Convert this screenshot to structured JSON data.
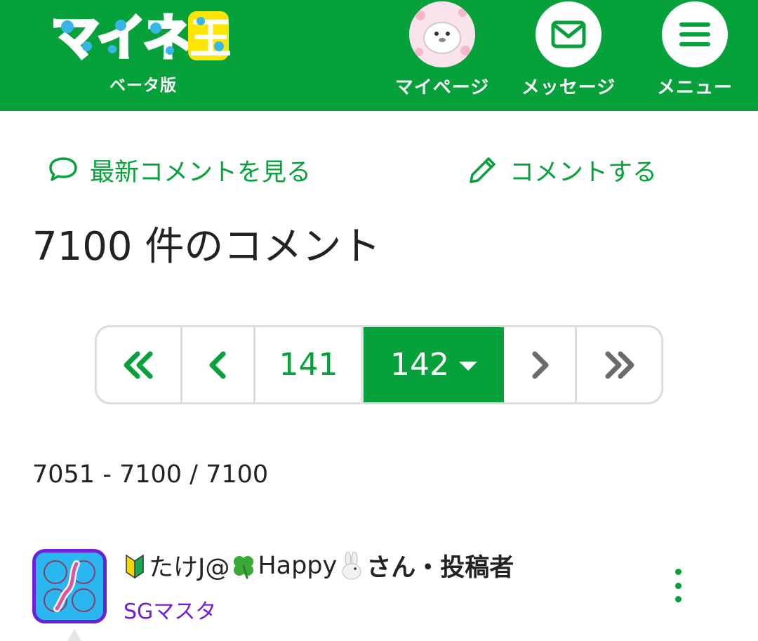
{
  "header": {
    "logo_text": "マイネ王",
    "logo_sub": "ベータ版",
    "brand_color": "#06a13a",
    "nav": {
      "mypage_label": "マイページ",
      "message_label": "メッセージ",
      "menu_label": "メニュー"
    }
  },
  "actions": {
    "latest_label": "最新コメントを見る",
    "post_label": "コメントする"
  },
  "comments_title": {
    "count": "7100",
    "label": "件のコメント"
  },
  "pagination": {
    "prev_page": "141",
    "current_page": "142",
    "current_is_dropdown": true
  },
  "range_text": "7051 - 7100 / 7100",
  "comment": {
    "author_name": "たけJ@",
    "author_name2": "Happy",
    "author_suffix": "さん・投稿者",
    "rank": "SGマスタ",
    "rank_color": "#6f1fd6"
  }
}
